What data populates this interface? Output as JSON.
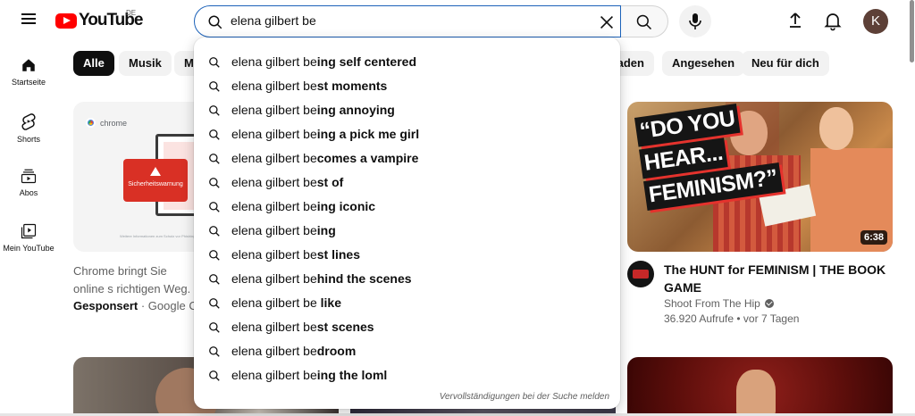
{
  "header": {
    "logo_text": "YouTube",
    "country_code": "DE",
    "search_value": "elena gilbert be",
    "avatar_letter": "K"
  },
  "sidebar": {
    "items": [
      {
        "label": "Startseite",
        "icon": "home-icon"
      },
      {
        "label": "Shorts",
        "icon": "shorts-icon"
      },
      {
        "label": "Abos",
        "icon": "subscriptions-icon"
      },
      {
        "label": "Mein YouTube",
        "icon": "library-icon"
      }
    ]
  },
  "chips": [
    "Alle",
    "Musik",
    "Mi",
    "laden",
    "Angesehen",
    "Neu für dich"
  ],
  "ad": {
    "brand": "chrome",
    "warning": "Sicherheitswarnung",
    "footer": "Weitere Informationen zum Schutz vor Phishing",
    "text": "Chrome bringt Sie online s richtigen Weg.",
    "sponsored": "Gesponsert",
    "advertiser": " · Google Chro"
  },
  "video": {
    "thumb_lines": [
      "“DO YOU",
      "HEAR...",
      "FEMINISM?”"
    ],
    "duration": "6:38",
    "title": "The HUNT for FEMINISM | THE BOOK GAME",
    "channel": "Shoot From The Hip",
    "stats": "36.920 Aufrufe • vor 7 Tagen"
  },
  "suggestions": [
    {
      "prefix": "elena gilbert be",
      "rest": "ing self centered"
    },
    {
      "prefix": "elena gilbert be",
      "rest": "st moments"
    },
    {
      "prefix": "elena gilbert be",
      "rest": "ing annoying"
    },
    {
      "prefix": "elena gilbert be",
      "rest": "ing a pick me girl"
    },
    {
      "prefix": "elena gilbert be",
      "rest": "comes a vampire"
    },
    {
      "prefix": "elena gilbert be",
      "rest": "st of"
    },
    {
      "prefix": "elena gilbert be",
      "rest": "ing iconic"
    },
    {
      "prefix": "elena gilbert be",
      "rest": "ing"
    },
    {
      "prefix": "elena gilbert be",
      "rest": "st lines"
    },
    {
      "prefix": "elena gilbert be",
      "rest": "hind the scenes"
    },
    {
      "prefix": "elena gilbert be",
      "rest": " like"
    },
    {
      "prefix": "elena gilbert be",
      "rest": "st scenes"
    },
    {
      "prefix": "elena gilbert be",
      "rest": "droom"
    },
    {
      "prefix": "elena gilbert be",
      "rest": "ing the loml"
    }
  ],
  "suggest_report": "Vervollständigungen bei der Suche melden"
}
